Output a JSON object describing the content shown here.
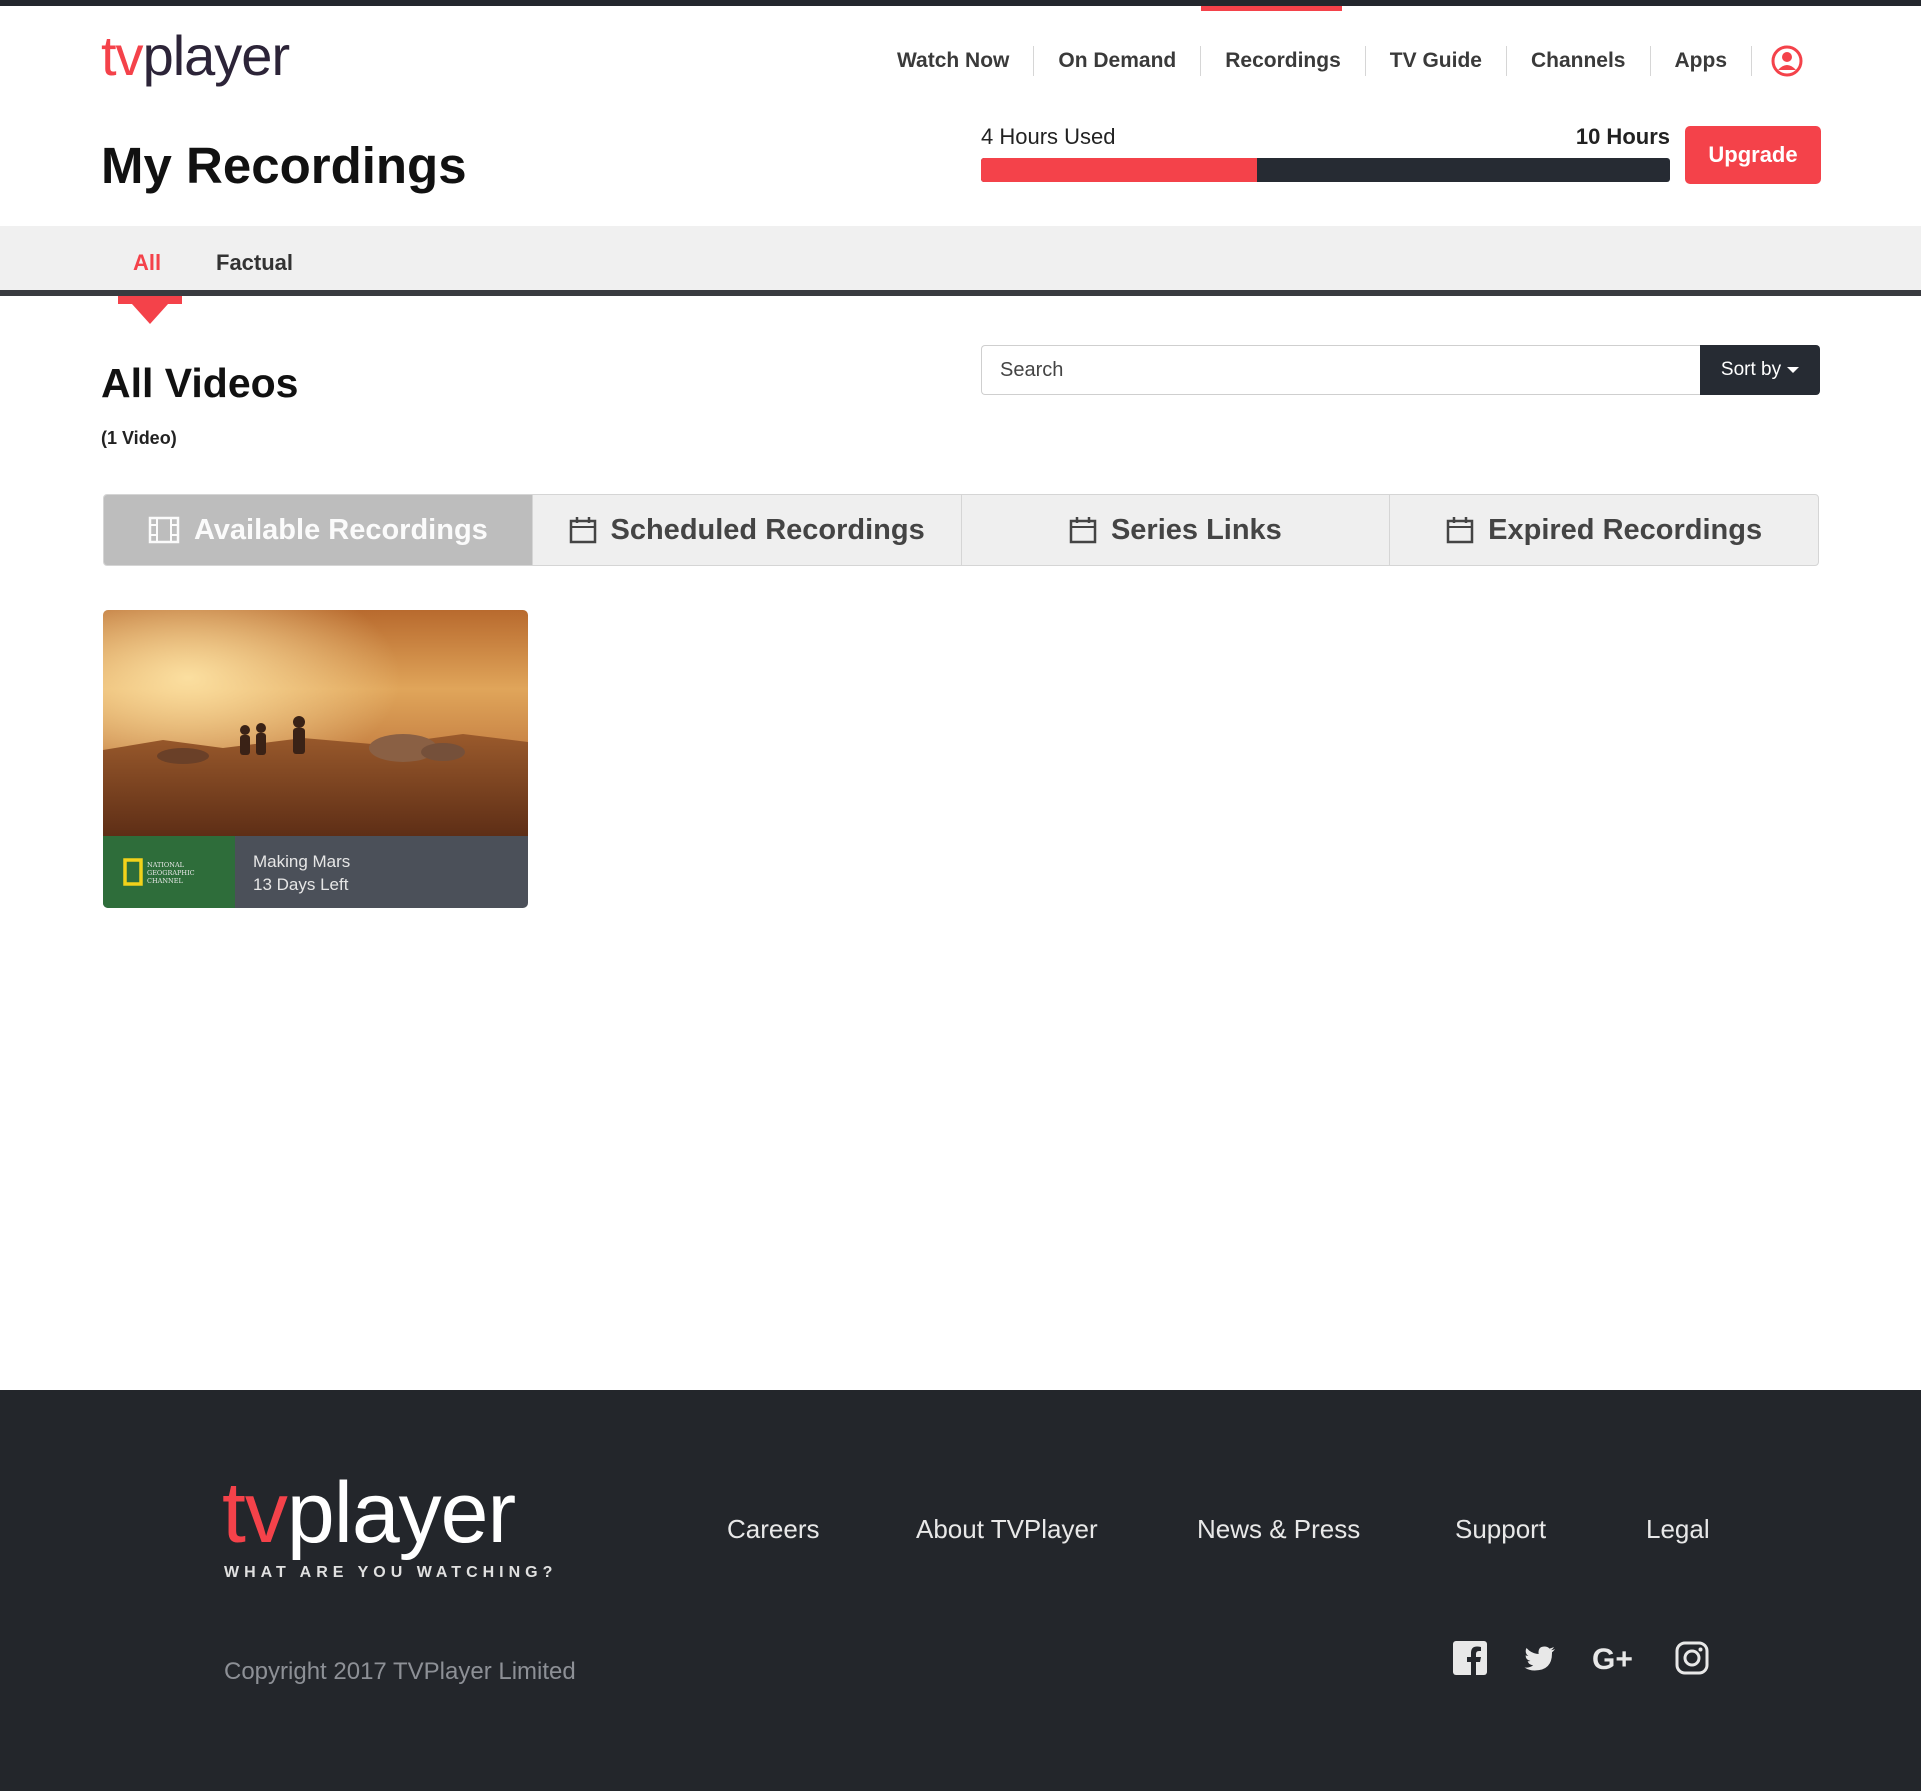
{
  "brand": {
    "logo_tv": "tv",
    "logo_player": "player",
    "accent": "#f4424a",
    "dark": "#262b33"
  },
  "nav": {
    "items": [
      {
        "label": "Watch Now"
      },
      {
        "label": "On Demand"
      },
      {
        "label": "Recordings"
      },
      {
        "label": "TV Guide"
      },
      {
        "label": "Channels"
      },
      {
        "label": "Apps"
      }
    ],
    "active": "Recordings",
    "profile_icon": "user-circle-icon"
  },
  "page": {
    "title": "My Recordings"
  },
  "usage": {
    "used_label": "4 Hours Used",
    "max_label": "10 Hours",
    "used_fraction": 0.4,
    "upgrade_label": "Upgrade"
  },
  "categories": {
    "items": [
      "All",
      "Factual"
    ],
    "active": "All"
  },
  "section": {
    "title": "All Videos",
    "count": "(1 Video)"
  },
  "search": {
    "placeholder": "Search",
    "value": "",
    "sort_label": "Sort by"
  },
  "recording_tabs": [
    {
      "label": "Available Recordings",
      "icon": "film-icon",
      "active": true
    },
    {
      "label": "Scheduled Recordings",
      "icon": "calendar-icon",
      "active": false
    },
    {
      "label": "Series Links",
      "icon": "calendar-icon",
      "active": false
    },
    {
      "label": "Expired Recordings",
      "icon": "calendar-icon",
      "active": false
    }
  ],
  "recordings": [
    {
      "title": "Making Mars",
      "remaining": "13 Days Left",
      "channel": "National Geographic Channel",
      "channel_logo_text": "NATIONAL GEOGRAPHIC CHANNEL"
    }
  ],
  "footer": {
    "logo_tv": "tv",
    "logo_player": "player",
    "tagline": "WHAT ARE YOU WATCHING?",
    "links": [
      "Careers",
      "About TVPlayer",
      "News & Press",
      "Support",
      "Legal"
    ],
    "copyright": "Copyright 2017 TVPlayer Limited",
    "social": [
      "facebook-icon",
      "twitter-icon",
      "google-plus-icon",
      "instagram-icon"
    ]
  }
}
